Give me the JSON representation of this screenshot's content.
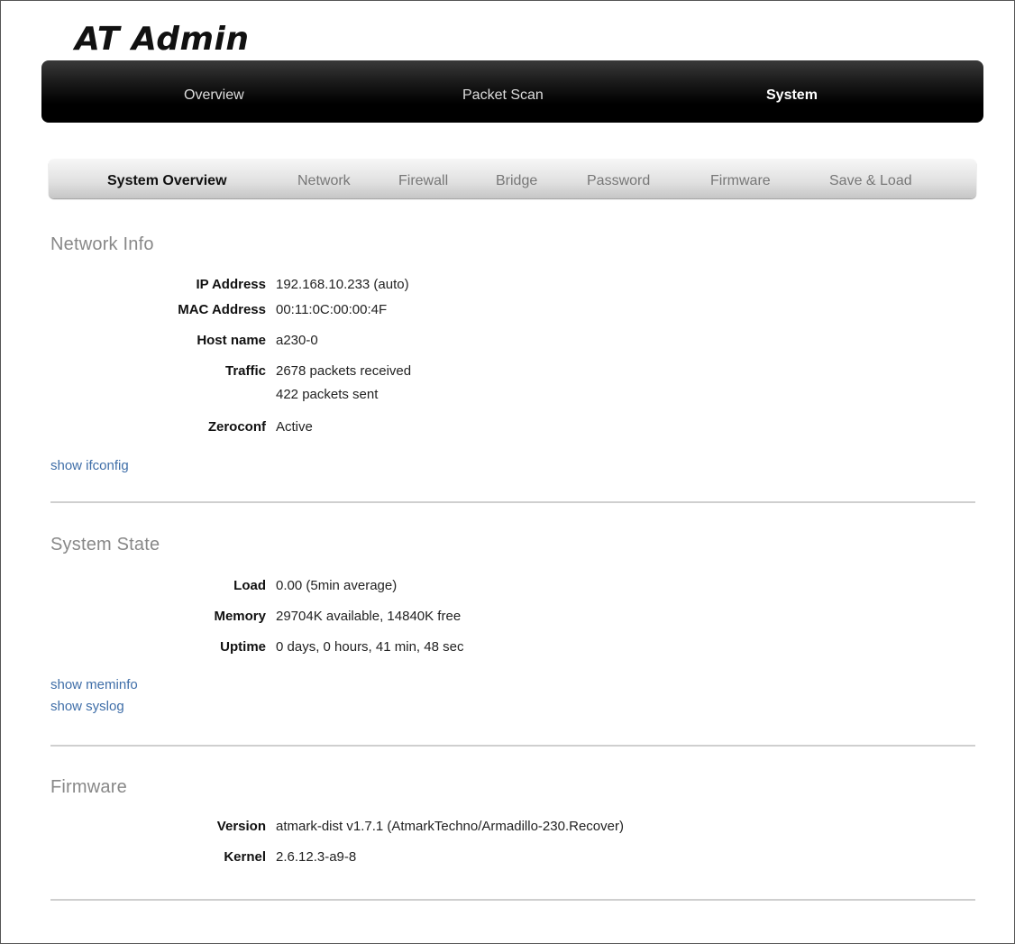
{
  "app": {
    "title": "AT Admin"
  },
  "main_nav": {
    "overview": "Overview",
    "packet_scan": "Packet Scan",
    "system": "System"
  },
  "sub_nav": {
    "system_overview": "System Overview",
    "network": "Network",
    "firewall": "Firewall",
    "bridge": "Bridge",
    "password": "Password",
    "firmware": "Firmware",
    "save_load": "Save & Load"
  },
  "network_info": {
    "title": "Network Info",
    "ip_label": "IP Address",
    "ip_value": "192.168.10.233 (auto)",
    "mac_label": "MAC Address",
    "mac_value": "00:11:0C:00:00:4F",
    "host_label": "Host name",
    "host_value": "a230-0",
    "traffic_label": "Traffic",
    "traffic_received": "2678 packets received",
    "traffic_sent": "422 packets sent",
    "zeroconf_label": "Zeroconf",
    "zeroconf_value": "Active",
    "show_ifconfig": "show ifconfig"
  },
  "system_state": {
    "title": "System State",
    "load_label": "Load",
    "load_value": "0.00 (5min average)",
    "memory_label": "Memory",
    "memory_value": "29704K available, 14840K free",
    "uptime_label": "Uptime",
    "uptime_value": "0 days, 0 hours, 41 min, 48 sec",
    "show_meminfo": "show meminfo",
    "show_syslog": "show syslog"
  },
  "firmware": {
    "title": "Firmware",
    "version_label": "Version",
    "version_value": "atmark-dist v1.7.1 (AtmarkTechno/Armadillo-230.Recover)",
    "kernel_label": "Kernel",
    "kernel_value": "2.6.12.3-a9-8"
  }
}
